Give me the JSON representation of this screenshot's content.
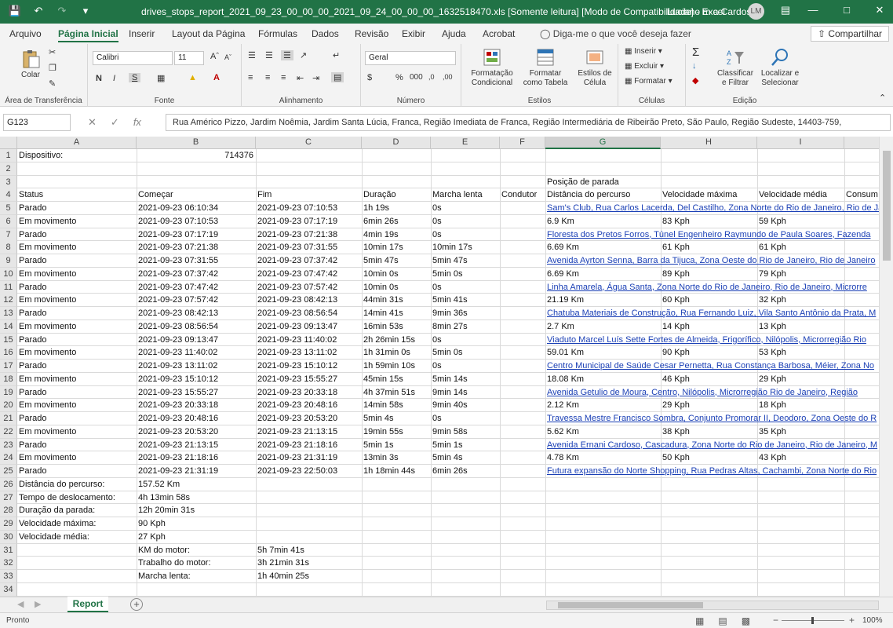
{
  "titlebar": {
    "title": "drives_stops_report_2021_09_23_00_00_00_2021_09_24_00_00_00_1632518470.xls  [Somente leitura]  [Modo de Compatibilidade]  -  Excel",
    "user": "Luciano m a Cardoso",
    "avatar": "LM",
    "icons": [
      "save-icon",
      "undo-icon",
      "redo-icon",
      "customize-qat-icon",
      "ribbon-options-icon",
      "minimize-icon",
      "restore-icon",
      "close-icon"
    ]
  },
  "menu": {
    "tabs": [
      "Arquivo",
      "Página Inicial",
      "Inserir",
      "Layout da Página",
      "Fórmulas",
      "Dados",
      "Revisão",
      "Exibir",
      "Ajuda",
      "Acrobat"
    ],
    "active": "Página Inicial",
    "tellme": "Diga-me o que você deseja fazer",
    "share": "Compartilhar"
  },
  "ribbon": {
    "clipboard": {
      "paste": "Colar",
      "label": "Área de Transferência"
    },
    "font": {
      "name": "Calibri",
      "size": "11",
      "bold": "N",
      "italic": "I",
      "underline": "S",
      "label": "Fonte"
    },
    "alignment": {
      "label": "Alinhamento"
    },
    "number": {
      "format": "Geral",
      "label": "Número"
    },
    "styles": {
      "conditional": "Formatação Condicional",
      "table": "Formatar como Tabela",
      "cell": "Estilos de Célula",
      "label": "Estilos"
    },
    "cells": {
      "insert": "Inserir",
      "delete": "Excluir",
      "format": "Formatar",
      "label": "Células"
    },
    "editing": {
      "sort": "Classificar e Filtrar",
      "find": "Localizar e Selecionar",
      "label": "Edição"
    }
  },
  "formula": {
    "namebox": "G123",
    "content": "Rua Américo Pizzo, Jardim Noêmia, Jardim Santa Lúcia, Franca, Região Imediata de Franca, Região Intermediária de Ribeirão Preto, São Paulo, Região Sudeste, 14403-759,"
  },
  "columns": [
    "A",
    "B",
    "C",
    "D",
    "E",
    "F",
    "G",
    "H",
    "I"
  ],
  "selected_column": "G",
  "row_numbers": [
    "1",
    "2",
    "3",
    "4",
    "5",
    "6",
    "7",
    "8",
    "9",
    "10",
    "11",
    "12",
    "13",
    "14",
    "15",
    "16",
    "17",
    "18",
    "19",
    "20",
    "21",
    "22",
    "23",
    "24",
    "25",
    "26",
    "27",
    "28",
    "29",
    "30",
    "31",
    "32",
    "33",
    "34"
  ],
  "sheet": {
    "row1": {
      "a": "Dispositivo:",
      "b": "714376"
    },
    "row3": {
      "g": "Posição de parada"
    },
    "headers": [
      "Status",
      "Começar",
      "Fim",
      "Duração",
      "Marcha lenta",
      "Condutor",
      "Distância do percurso",
      "Velocidade máxima",
      "Velocidade média",
      "Consum"
    ],
    "rows": [
      {
        "status": "Parado",
        "start": "2021-09-23 06:10:34",
        "end": "2021-09-23 07:10:53",
        "dur": "1h 19s",
        "idle": "0s",
        "g": "Sam's Club, Rua Carlos Lacerda, Del Castilho, Zona Norte do Rio de Janeiro, Rio de Janeiro",
        "link": true
      },
      {
        "status": "Em movimento",
        "start": "2021-09-23 07:10:53",
        "end": "2021-09-23 07:17:19",
        "dur": "6min 26s",
        "idle": "0s",
        "g": "6.9 Km",
        "h": "83 Kph",
        "i": "59 Kph"
      },
      {
        "status": "Parado",
        "start": "2021-09-23 07:17:19",
        "end": "2021-09-23 07:21:38",
        "dur": "4min 19s",
        "idle": "0s",
        "g": "Floresta dos Pretos Forros, Túnel Engenheiro Raymundo de Paula Soares, Fazenda",
        "link": true
      },
      {
        "status": "Em movimento",
        "start": "2021-09-23 07:21:38",
        "end": "2021-09-23 07:31:55",
        "dur": "10min 17s",
        "idle": "10min 17s",
        "g": "6.69 Km",
        "h": "61 Kph",
        "i": "61 Kph"
      },
      {
        "status": "Parado",
        "start": "2021-09-23 07:31:55",
        "end": "2021-09-23 07:37:42",
        "dur": "5min 47s",
        "idle": "5min 47s",
        "g": "Avenida Ayrton Senna, Barra da Tijuca, Zona Oeste do Rio de Janeiro, Rio de Janeiro",
        "link": true
      },
      {
        "status": "Em movimento",
        "start": "2021-09-23 07:37:42",
        "end": "2021-09-23 07:47:42",
        "dur": "10min 0s",
        "idle": "5min 0s",
        "g": "6.69 Km",
        "h": "89 Kph",
        "i": "79 Kph"
      },
      {
        "status": "Parado",
        "start": "2021-09-23 07:47:42",
        "end": "2021-09-23 07:57:42",
        "dur": "10min 0s",
        "idle": "0s",
        "g": "Linha Amarela, Água Santa, Zona Norte do Rio de Janeiro, Rio de Janeiro, Microrre",
        "link": true
      },
      {
        "status": "Em movimento",
        "start": "2021-09-23 07:57:42",
        "end": "2021-09-23 08:42:13",
        "dur": "44min 31s",
        "idle": "5min 41s",
        "g": "21.19 Km",
        "h": "60 Kph",
        "i": "32 Kph"
      },
      {
        "status": "Parado",
        "start": "2021-09-23 08:42:13",
        "end": "2021-09-23 08:56:54",
        "dur": "14min 41s",
        "idle": "9min 36s",
        "g": "Chatuba Materiais de Construção, Rua Fernando Luiz, Vila Santo Antônio da Prata, M",
        "link": true
      },
      {
        "status": "Em movimento",
        "start": "2021-09-23 08:56:54",
        "end": "2021-09-23 09:13:47",
        "dur": "16min 53s",
        "idle": "8min 27s",
        "g": "2.7 Km",
        "h": "14 Kph",
        "i": "13 Kph"
      },
      {
        "status": "Parado",
        "start": "2021-09-23 09:13:47",
        "end": "2021-09-23 11:40:02",
        "dur": "2h 26min 15s",
        "idle": "0s",
        "g": "Viaduto Marcel Luís Sette Fortes de Almeida, Frigorífico, Nilópolis, Microrregião Rio",
        "link": true
      },
      {
        "status": "Em movimento",
        "start": "2021-09-23 11:40:02",
        "end": "2021-09-23 13:11:02",
        "dur": "1h 31min 0s",
        "idle": "5min 0s",
        "g": "59.01 Km",
        "h": "90 Kph",
        "i": "53 Kph"
      },
      {
        "status": "Parado",
        "start": "2021-09-23 13:11:02",
        "end": "2021-09-23 15:10:12",
        "dur": "1h 59min 10s",
        "idle": "0s",
        "g": "Centro Municipal de Saúde Cesar Pernetta, Rua Constança Barbosa, Méier, Zona No",
        "link": true
      },
      {
        "status": "Em movimento",
        "start": "2021-09-23 15:10:12",
        "end": "2021-09-23 15:55:27",
        "dur": "45min 15s",
        "idle": "5min 14s",
        "g": "18.08 Km",
        "h": "46 Kph",
        "i": "29 Kph"
      },
      {
        "status": "Parado",
        "start": "2021-09-23 15:55:27",
        "end": "2021-09-23 20:33:18",
        "dur": "4h 37min 51s",
        "idle": "9min 14s",
        "g": "Avenida Getulio de Moura, Centro, Nilópolis, Microrregião Rio de Janeiro, Região",
        "link": true
      },
      {
        "status": "Em movimento",
        "start": "2021-09-23 20:33:18",
        "end": "2021-09-23 20:48:16",
        "dur": "14min 58s",
        "idle": "9min 40s",
        "g": "2.12 Km",
        "h": "29 Kph",
        "i": "18 Kph"
      },
      {
        "status": "Parado",
        "start": "2021-09-23 20:48:16",
        "end": "2021-09-23 20:53:20",
        "dur": "5min 4s",
        "idle": "0s",
        "g": "Travessa Mestre Francisco Sombra, Conjunto Promorar II, Deodoro, Zona Oeste do R",
        "link": true
      },
      {
        "status": "Em movimento",
        "start": "2021-09-23 20:53:20",
        "end": "2021-09-23 21:13:15",
        "dur": "19min 55s",
        "idle": "9min 58s",
        "g": "5.62 Km",
        "h": "38 Kph",
        "i": "35 Kph"
      },
      {
        "status": "Parado",
        "start": "2021-09-23 21:13:15",
        "end": "2021-09-23 21:18:16",
        "dur": "5min 1s",
        "idle": "5min 1s",
        "g": "Avenida Ernani Cardoso, Cascadura, Zona Norte do Rio de Janeiro, Rio de Janeiro, M",
        "link": true
      },
      {
        "status": "Em movimento",
        "start": "2021-09-23 21:18:16",
        "end": "2021-09-23 21:31:19",
        "dur": "13min 3s",
        "idle": "5min 4s",
        "g": "4.78 Km",
        "h": "50 Kph",
        "i": "43 Kph"
      },
      {
        "status": "Parado",
        "start": "2021-09-23 21:31:19",
        "end": "2021-09-23 22:50:03",
        "dur": "1h 18min 44s",
        "idle": "6min 26s",
        "g": "Futura expansão do Norte Shopping, Rua Pedras Altas, Cachambi, Zona Norte do Rio",
        "link": true
      }
    ],
    "summary": [
      {
        "label": "Distância do percurso:",
        "value": "157.52 Km"
      },
      {
        "label": "Tempo de deslocamento:",
        "value": "4h 13min 58s"
      },
      {
        "label": "Duração da parada:",
        "value": "12h 20min 31s"
      },
      {
        "label": "Velocidade máxima:",
        "value": "90 Kph"
      },
      {
        "label": "Velocidade média:",
        "value": "27 Kph"
      }
    ],
    "engine": [
      {
        "label": "KM do motor:",
        "value": "5h 7min 41s"
      },
      {
        "label": "Trabalho do motor:",
        "value": "3h 21min 31s"
      },
      {
        "label": "Marcha lenta:",
        "value": "1h 40min 25s"
      }
    ]
  },
  "sheettabs": {
    "active": "Report"
  },
  "status": {
    "ready": "Pronto",
    "zoom": "100%"
  }
}
